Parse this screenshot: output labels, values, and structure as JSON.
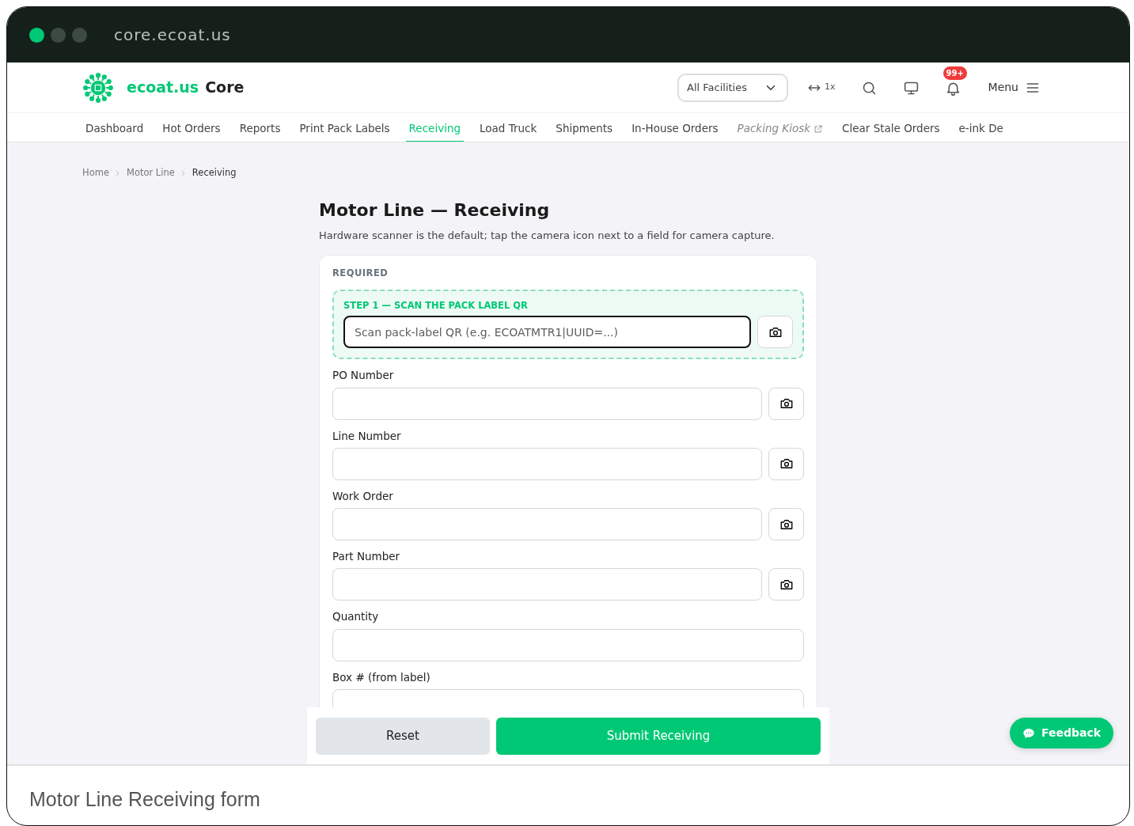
{
  "window": {
    "title": "core.ecoat.us",
    "dots": [
      {
        "color": "#00c875"
      },
      {
        "color": "#3d4a44"
      },
      {
        "color": "#3d4a44"
      }
    ]
  },
  "header": {
    "brand": "ecoat.us",
    "product": "Core",
    "facility": "All Facilities",
    "zoom": "1x",
    "notifications": "99+",
    "menu": "Menu"
  },
  "nav": [
    {
      "label": "Dashboard",
      "selected": false,
      "external": false
    },
    {
      "label": "Hot Orders",
      "selected": false,
      "external": false
    },
    {
      "label": "Reports",
      "selected": false,
      "external": false
    },
    {
      "label": "Print Pack Labels",
      "selected": false,
      "external": false
    },
    {
      "label": "Receiving",
      "selected": true,
      "external": false
    },
    {
      "label": "Load Truck",
      "selected": false,
      "external": false
    },
    {
      "label": "Shipments",
      "selected": false,
      "external": false
    },
    {
      "label": "In-House Orders",
      "selected": false,
      "external": false
    },
    {
      "label": "Packing Kiosk",
      "selected": false,
      "external": true
    },
    {
      "label": "Clear Stale Orders",
      "selected": false,
      "external": false
    },
    {
      "label": "e-ink De",
      "selected": false,
      "external": false
    }
  ],
  "breadcrumb": [
    {
      "label": "Home",
      "current": false
    },
    {
      "label": "Motor Line",
      "current": false
    },
    {
      "label": "Receiving",
      "current": true
    }
  ],
  "page": {
    "title": "Motor Line — Receiving",
    "subtitle": "Hardware scanner is the default; tap the camera icon next to a field for camera capture."
  },
  "form": {
    "section": "REQUIRED",
    "scan": {
      "label": "STEP 1 — SCAN THE PACK LABEL QR",
      "placeholder": "Scan pack-label QR (e.g. ECOATMTR1|UUID=...)"
    },
    "fields": [
      {
        "label": "PO Number",
        "camera": true
      },
      {
        "label": "Line Number",
        "camera": true
      },
      {
        "label": "Work Order",
        "camera": true
      },
      {
        "label": "Part Number",
        "camera": true
      },
      {
        "label": "Quantity",
        "camera": false
      },
      {
        "label": "Box # (from label)",
        "camera": false
      }
    ]
  },
  "actions": {
    "reset": "Reset",
    "submit": "Submit Receiving"
  },
  "feedback": "Feedback",
  "caption": "Motor Line Receiving form"
}
